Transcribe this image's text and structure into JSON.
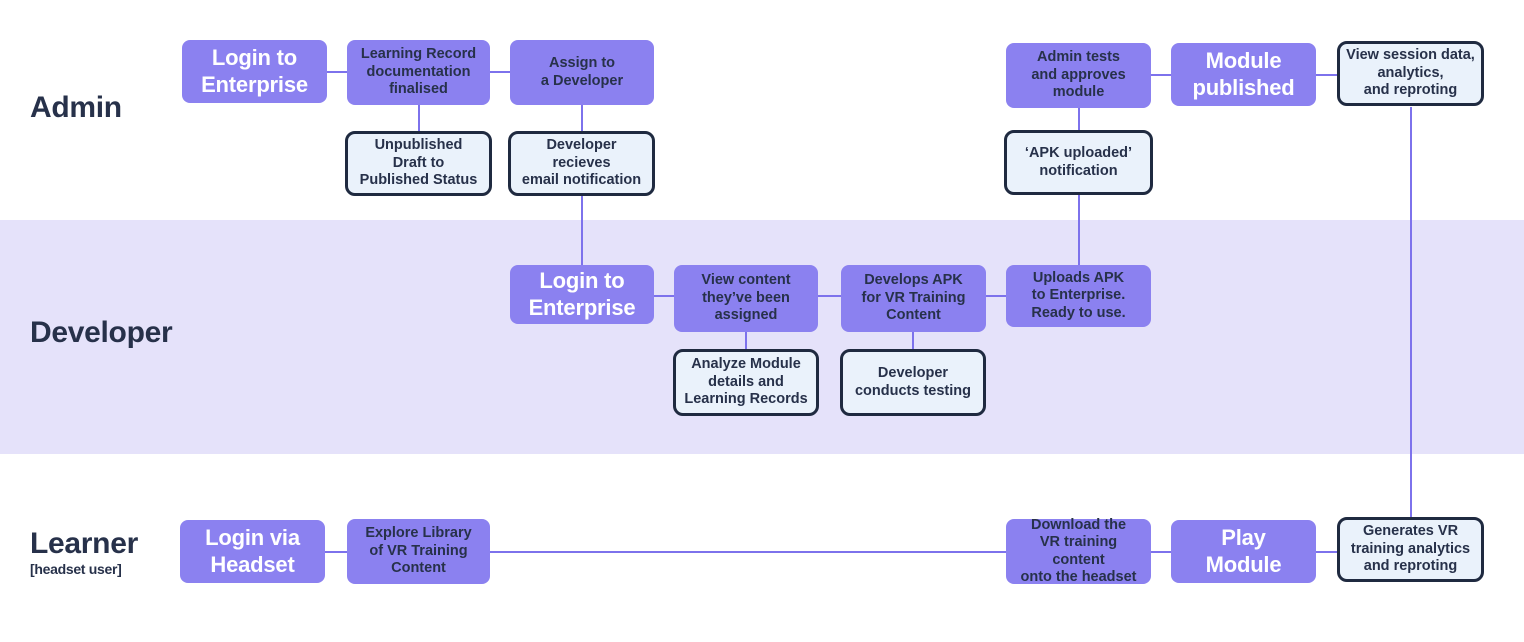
{
  "diagram": {
    "title": "VR Training Platform User Journey Swimlane",
    "colors": {
      "node_fill": "#8b81f0",
      "node_text": "#27314a",
      "node_text_inverse": "#ffffff",
      "outline_fill": "#eaf2fb",
      "outline_border": "#1f2a40",
      "band_fill": "#e5e2fa",
      "connector": "#7d72ec",
      "page_background": "#ffffff"
    }
  },
  "lanes": [
    {
      "id": "admin",
      "title": "Admin",
      "subtitle": "",
      "shaded": false
    },
    {
      "id": "developer",
      "title": "Developer",
      "subtitle": "",
      "shaded": true
    },
    {
      "id": "learner",
      "title": "Learner",
      "subtitle": "[headset user]",
      "shaded": false
    }
  ],
  "nodes": {
    "admin": [
      {
        "id": "admin-login",
        "label": "Login to\nEnterprise",
        "style": "primary-big"
      },
      {
        "id": "admin-learning-record",
        "label": "Learning Record\ndocumentation\nfinalised",
        "style": "primary"
      },
      {
        "id": "admin-assign-developer",
        "label": "Assign to\na Developer",
        "style": "primary"
      },
      {
        "id": "admin-unpublished",
        "label": "Unpublished\nDraft to\nPublished Status",
        "style": "outline"
      },
      {
        "id": "admin-dev-email",
        "label": "Developer recieves\nemail notification",
        "style": "outline"
      },
      {
        "id": "admin-tests-approves",
        "label": "Admin tests\nand approves\nmodule",
        "style": "primary"
      },
      {
        "id": "admin-apk-uploaded",
        "label": "‘APK uploaded’\nnotification",
        "style": "outline"
      },
      {
        "id": "admin-module-published",
        "label": "Module\npublished",
        "style": "primary-big"
      },
      {
        "id": "admin-view-session",
        "label": "View session data,\nanalytics,\nand reproting",
        "style": "outline"
      }
    ],
    "developer": [
      {
        "id": "dev-login",
        "label": "Login to\nEnterprise",
        "style": "primary-big"
      },
      {
        "id": "dev-view-content",
        "label": "View content\nthey’ve been\nassigned",
        "style": "primary"
      },
      {
        "id": "dev-analyze-module",
        "label": "Analyze Module\ndetails and\nLearning Records",
        "style": "outline"
      },
      {
        "id": "dev-develops-apk",
        "label": "Develops APK\nfor VR Training\nContent",
        "style": "primary"
      },
      {
        "id": "dev-testing",
        "label": "Developer\nconducts testing",
        "style": "outline"
      },
      {
        "id": "dev-uploads-apk",
        "label": "Uploads APK\nto Enterprise.\nReady to use.",
        "style": "primary"
      }
    ],
    "learner": [
      {
        "id": "learner-login",
        "label": "Login via\nHeadset",
        "style": "primary-big"
      },
      {
        "id": "learner-explore",
        "label": "Explore Library\nof VR Training\nContent",
        "style": "primary"
      },
      {
        "id": "learner-download",
        "label": "Download the\nVR training content\nonto the headset",
        "style": "primary"
      },
      {
        "id": "learner-play",
        "label": "Play\nModule",
        "style": "primary-big"
      },
      {
        "id": "learner-generates",
        "label": "Generates VR\ntraining analytics\nand reproting",
        "style": "outline"
      }
    ]
  }
}
